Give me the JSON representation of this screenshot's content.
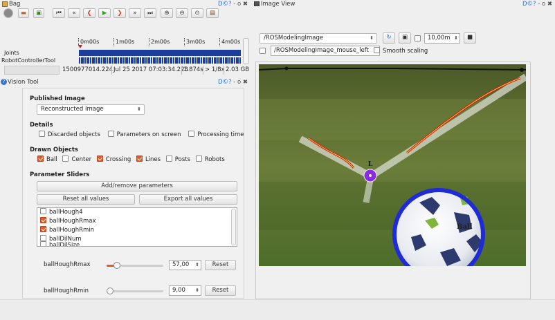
{
  "bag": {
    "title": "Bag",
    "window_controls": "- o ✖",
    "ticks": [
      "0m00s",
      "1m00s",
      "2m00s",
      "3m00s",
      "4m00s"
    ],
    "topics": [
      "Joints",
      "RobotControllerTool"
    ],
    "status": {
      "timestamp": "1500977014.224",
      "date": "Jul 25 2017 07:03:34.223",
      "elapsed": "1.874s",
      "speed": "> 1/8x",
      "size": "2.03 GB"
    }
  },
  "vision_tool": {
    "title": "Vision Tool",
    "window_controls": "- o ✖",
    "published_image_heading": "Published Image",
    "published_image_value": "Reconstructed Image",
    "details_heading": "Details",
    "details": [
      {
        "label": "Discarded objects",
        "checked": false
      },
      {
        "label": "Parameters on screen",
        "checked": false
      },
      {
        "label": "Processing time",
        "checked": false
      }
    ],
    "drawn_heading": "Drawn Objects",
    "drawn": [
      {
        "label": "Ball",
        "checked": true
      },
      {
        "label": "Center",
        "checked": false
      },
      {
        "label": "Crossing",
        "checked": true
      },
      {
        "label": "Lines",
        "checked": true
      },
      {
        "label": "Posts",
        "checked": false
      },
      {
        "label": "Robots",
        "checked": false
      }
    ],
    "sliders_heading": "Parameter Sliders",
    "add_remove_label": "Add/remove parameters",
    "reset_all_label": "Reset all values",
    "export_all_label": "Export all values",
    "params": [
      {
        "label": "ballHough4",
        "checked": false
      },
      {
        "label": "ballHoughRmax",
        "checked": true
      },
      {
        "label": "ballHoughRmin",
        "checked": true
      },
      {
        "label": "ballDilNum",
        "checked": false
      },
      {
        "label": "ballDilSize",
        "checked": false
      }
    ],
    "slider1": {
      "label": "ballHoughRmax",
      "value": "57,00",
      "reset": "Reset",
      "level": 0.12
    },
    "slider2": {
      "label": "ballHoughRmin",
      "value": "9,00",
      "reset": "Reset",
      "level": 0.0
    }
  },
  "image_view": {
    "title": "Image View",
    "window_controls": "- o ✖",
    "topic": "/ROSModelingImage",
    "distance": "10,00m",
    "mouse_topic": "/ROSModelingImage_mouse_left",
    "smooth_label": "Smooth scaling",
    "smooth_checked": false,
    "label_l": "L",
    "label_ball": "Ball"
  },
  "colors": {
    "accent": "#e45b2a",
    "ball_circle": "#1e2bd6",
    "field_line": "#d01818",
    "crossing": "#8a2be2",
    "timeline": "#1b3d9c"
  }
}
